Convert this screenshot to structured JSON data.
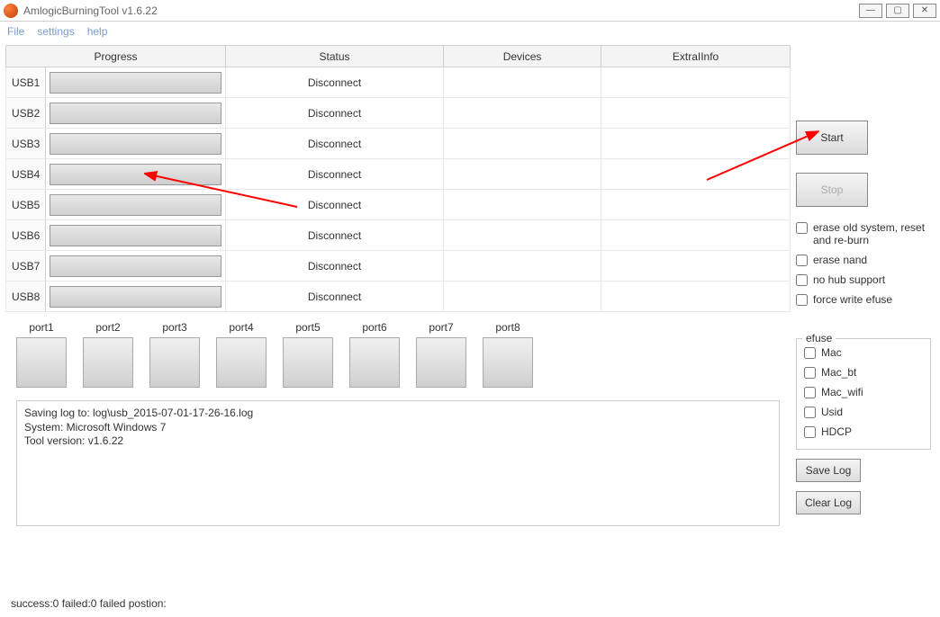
{
  "window": {
    "title": "AmlogicBurningTool  v1.6.22"
  },
  "menu": {
    "file": "File",
    "settings": "settings",
    "help": "help"
  },
  "table": {
    "headers": {
      "progress": "Progress",
      "status": "Status",
      "devices": "Devices",
      "extra": "ExtraIInfo"
    },
    "rows": [
      {
        "label": "USB1",
        "status": "Disconnect"
      },
      {
        "label": "USB2",
        "status": "Disconnect"
      },
      {
        "label": "USB3",
        "status": "Disconnect"
      },
      {
        "label": "USB4",
        "status": "Disconnect"
      },
      {
        "label": "USB5",
        "status": "Disconnect"
      },
      {
        "label": "USB6",
        "status": "Disconnect"
      },
      {
        "label": "USB7",
        "status": "Disconnect"
      },
      {
        "label": "USB8",
        "status": "Disconnect"
      }
    ]
  },
  "ports": [
    "port1",
    "port2",
    "port3",
    "port4",
    "port5",
    "port6",
    "port7",
    "port8"
  ],
  "log": {
    "line1": "Saving log to: log\\usb_2015-07-01-17-26-16.log",
    "line2": "System: Microsoft Windows 7",
    "line3": "Tool version: v1.6.22"
  },
  "buttons": {
    "start": "Start",
    "stop": "Stop",
    "save_log": "Save Log",
    "clear_log": "Clear Log"
  },
  "checks": {
    "erase_old": "erase old system, reset and re-burn",
    "erase_nand": "erase nand",
    "no_hub": "no hub support",
    "force_efuse": "force write efuse"
  },
  "efuse": {
    "legend": "efuse",
    "mac": "Mac",
    "mac_bt": "Mac_bt",
    "mac_wifi": "Mac_wifi",
    "usid": "Usid",
    "hdcp": "HDCP"
  },
  "status_bar": "success:0 failed:0 failed postion:"
}
